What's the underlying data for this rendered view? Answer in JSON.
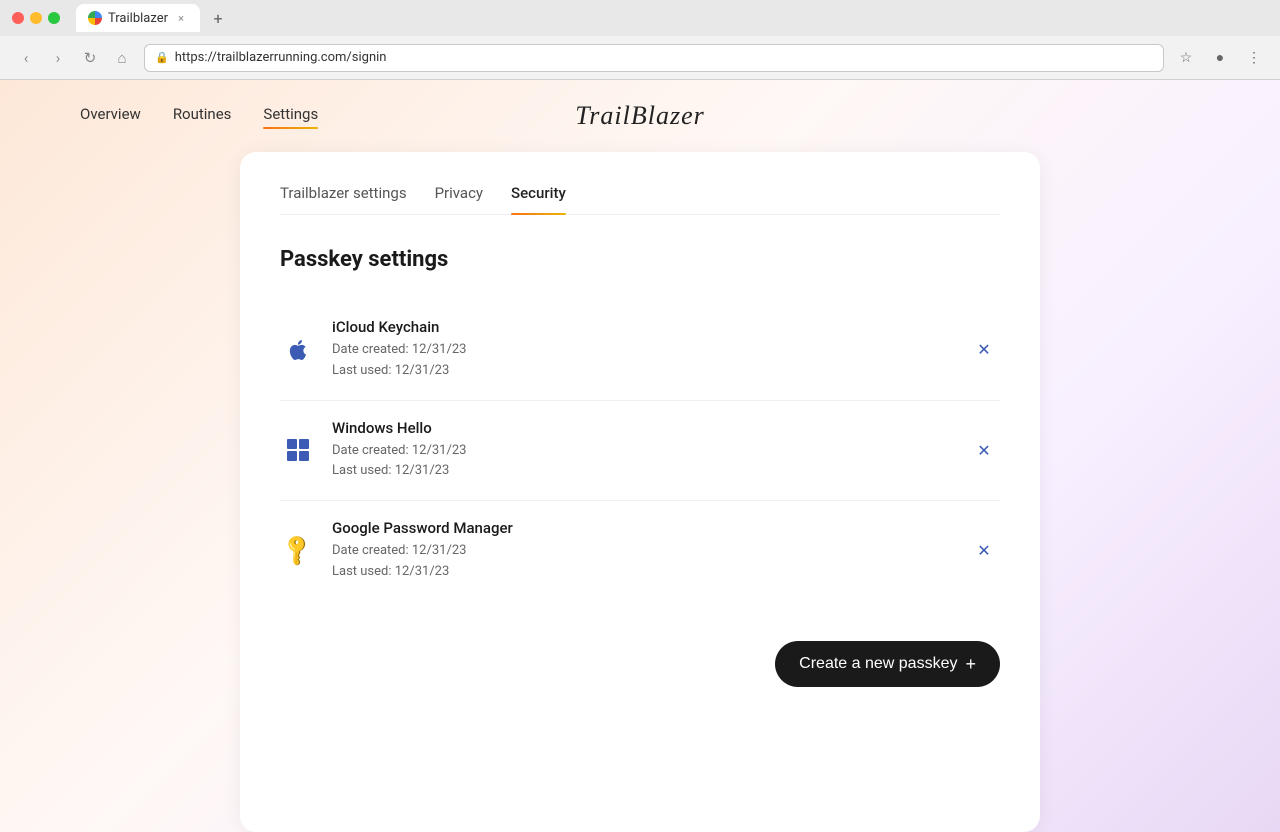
{
  "browser": {
    "tab_title": "Trailblazer",
    "url": "https://trailblazerrunning.com/signin",
    "close_tab": "×",
    "new_tab": "+",
    "nav": {
      "back": "‹",
      "forward": "›",
      "refresh": "↻",
      "home": "⌂"
    },
    "toolbar_icons": {
      "star": "☆",
      "profile": "●",
      "menu": "⋮"
    }
  },
  "site": {
    "logo": "TrailBlazer",
    "nav": {
      "links": [
        {
          "label": "Overview",
          "active": false
        },
        {
          "label": "Routines",
          "active": false
        },
        {
          "label": "Settings",
          "active": true
        }
      ]
    }
  },
  "settings": {
    "tabs": [
      {
        "label": "Trailblazer settings",
        "active": false
      },
      {
        "label": "Privacy",
        "active": false
      },
      {
        "label": "Security",
        "active": true
      }
    ],
    "section_title": "Passkey settings",
    "passkeys": [
      {
        "name": "iCloud Keychain",
        "date_created": "Date created: 12/31/23",
        "last_used": "Last used: 12/31/23",
        "icon_type": "apple"
      },
      {
        "name": "Windows Hello",
        "date_created": "Date created: 12/31/23",
        "last_used": "Last used: 12/31/23",
        "icon_type": "windows"
      },
      {
        "name": "Google Password Manager",
        "date_created": "Date created: 12/31/23",
        "last_used": "Last used: 12/31/23",
        "icon_type": "key"
      }
    ],
    "create_button_label": "Create a new passkey",
    "create_button_plus": "+"
  }
}
